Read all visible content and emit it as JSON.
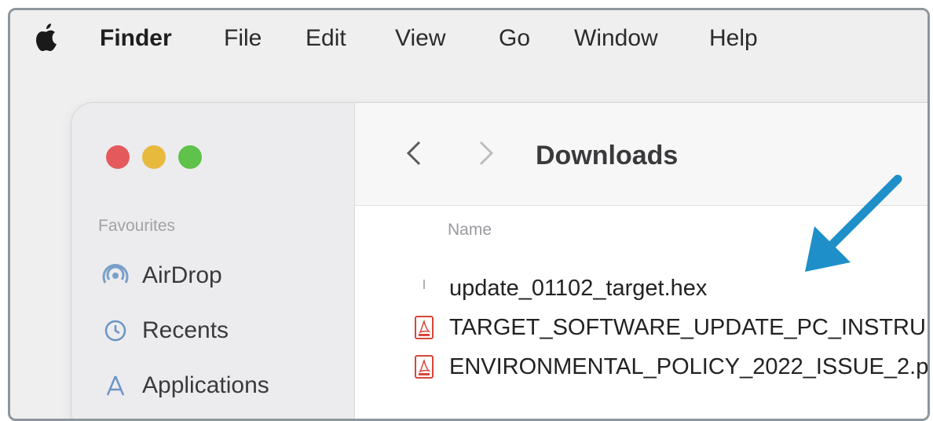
{
  "menubar": {
    "apple_icon": "apple-logo-icon",
    "items": [
      "Finder",
      "File",
      "Edit",
      "View",
      "Go",
      "Window",
      "Help"
    ]
  },
  "window": {
    "traffic_lights": {
      "close": "#e45a5c",
      "minimize": "#e7b93d",
      "zoom": "#5fc24a"
    },
    "toolbar": {
      "back_icon": "chevron-left-icon",
      "forward_icon": "chevron-right-icon",
      "title": "Downloads"
    },
    "sidebar": {
      "heading": "Favourites",
      "items": [
        {
          "label": "AirDrop",
          "icon": "airdrop-icon"
        },
        {
          "label": "Recents",
          "icon": "clock-icon"
        },
        {
          "label": "Applications",
          "icon": "applications-icon"
        }
      ]
    },
    "file_list": {
      "column_header": "Name",
      "rows": [
        {
          "name": "update_01102_target.hex",
          "icon": "generic-file-icon"
        },
        {
          "name": "TARGET_SOFTWARE_UPDATE_PC_INSTRU",
          "icon": "pdf-icon"
        },
        {
          "name": "ENVIRONMENTAL_POLICY_2022_ISSUE_2.p",
          "icon": "pdf-icon"
        }
      ]
    }
  },
  "annotation": {
    "arrow_color": "#1e8fc8"
  }
}
